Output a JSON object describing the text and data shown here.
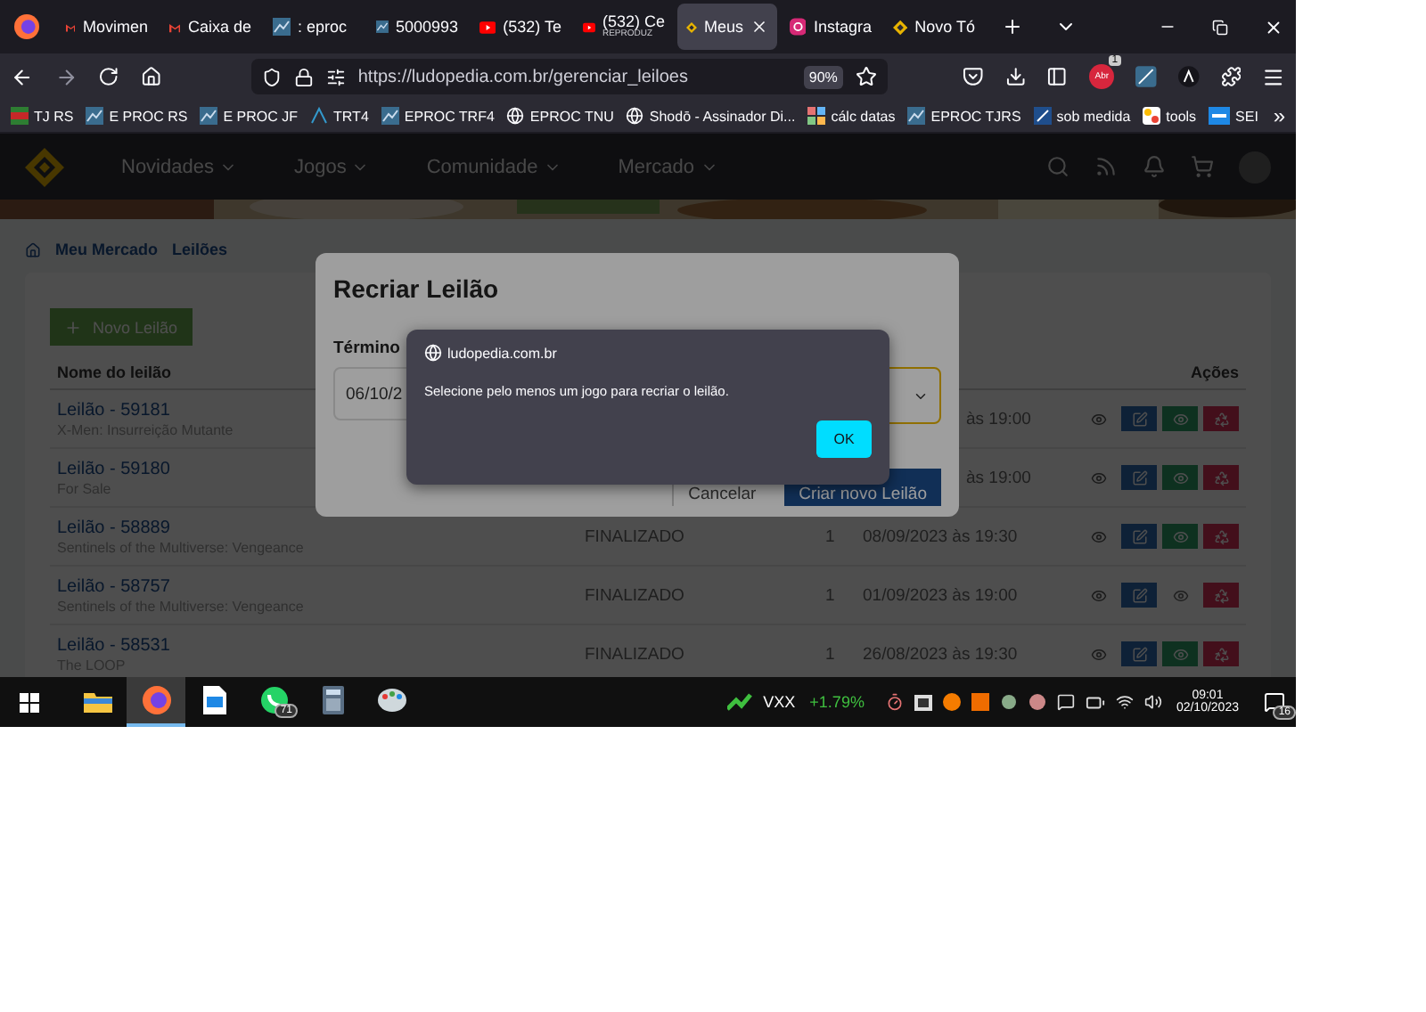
{
  "browser": {
    "tabs": [
      {
        "label": "Movimen",
        "kind": "gmail",
        "selected": false
      },
      {
        "label": "Caixa de",
        "kind": "gmail",
        "selected": false
      },
      {
        "label": ": eproc",
        "kind": "eproc",
        "selected": false
      },
      {
        "label": "5000993",
        "kind": "eproc",
        "selected": false
      },
      {
        "label": "(532) Te",
        "kind": "youtube",
        "selected": false
      },
      {
        "label": "(532) Ce",
        "sublabel": "REPRODUZ",
        "kind": "youtube",
        "selected": false
      },
      {
        "label": "Meus",
        "kind": "ludopedia",
        "selected": true
      },
      {
        "label": "Instagra",
        "kind": "instagram",
        "selected": false
      },
      {
        "label": "Novo Tó",
        "kind": "ludopedia",
        "selected": false
      }
    ],
    "url": "https://ludopedia.com.br/gerenciar_leiloes",
    "zoom": "90%",
    "extension_badge": "1",
    "extension_label": "Abr",
    "bookmarks": [
      {
        "label": "TJ RS",
        "kind": "flag"
      },
      {
        "label": "E PROC RS",
        "kind": "eproc"
      },
      {
        "label": "E PROC JF",
        "kind": "eproc"
      },
      {
        "label": "TRT4",
        "kind": "trt"
      },
      {
        "label": "EPROC TRF4",
        "kind": "eproc"
      },
      {
        "label": "EPROC TNU",
        "kind": "globe"
      },
      {
        "label": "Shodō - Assinador Di...",
        "kind": "globe"
      },
      {
        "label": "cálc datas",
        "kind": "apps"
      },
      {
        "label": "EPROC TJRS",
        "kind": "eproc"
      },
      {
        "label": "sob medida",
        "kind": "sob"
      },
      {
        "label": "tools",
        "kind": "tools"
      },
      {
        "label": "SEI",
        "kind": "sei"
      }
    ],
    "bookmarks_more": "»"
  },
  "site": {
    "nav": [
      "Novidades",
      "Jogos",
      "Comunidade",
      "Mercado"
    ],
    "breadcrumb": [
      "Meu Mercado",
      "Leilões"
    ],
    "new_button": "Novo Leilão",
    "columns": [
      "Nome do leilão",
      "Ações"
    ],
    "rows": [
      {
        "title": "Leilão - 59181",
        "subtitle": "X-Men: Insurreição Mutante",
        "date": "às 19:00",
        "kind": "partial",
        "published": true
      },
      {
        "title": "Leilão - 59180",
        "subtitle": "For Sale",
        "date": "às 19:00",
        "kind": "partial",
        "published": true
      },
      {
        "title": "Leilão - 58889",
        "subtitle": "Sentinels of the Multiverse: Vengeance",
        "status": "FINALIZADO",
        "quantity": "1",
        "date": "08/09/2023 às 19:30",
        "kind": "full",
        "published": true
      },
      {
        "title": "Leilão - 58757",
        "subtitle": "Sentinels of the Multiverse: Vengeance",
        "status": "FINALIZADO",
        "quantity": "1",
        "date": "01/09/2023 às 19:00",
        "kind": "full",
        "published": false
      },
      {
        "title": "Leilão - 58531",
        "subtitle": "The LOOP",
        "status": "FINALIZADO",
        "quantity": "1",
        "date": "26/08/2023 às 19:30",
        "kind": "full",
        "published": true
      }
    ]
  },
  "modal": {
    "title": "Recriar Leilão",
    "field_label": "Término",
    "date_value": "06/10/2",
    "cancel": "Cancelar",
    "confirm": "Criar novo Leilão"
  },
  "alert": {
    "origin": "ludopedia.com.br",
    "message": "Selecione pelo menos um jogo para recriar o leilão.",
    "ok": "OK"
  },
  "taskbar": {
    "apps": [
      {
        "kind": "explorer",
        "selected": false
      },
      {
        "kind": "firefox",
        "selected": true
      },
      {
        "kind": "document",
        "selected": false
      },
      {
        "kind": "whatsapp",
        "selected": false,
        "badge": "71"
      },
      {
        "kind": "calculator",
        "selected": false
      },
      {
        "kind": "paint",
        "selected": false
      }
    ],
    "ticker": "VXX",
    "change": "+1.79%",
    "time": "09:01",
    "date": "02/10/2023",
    "notifications": "16"
  }
}
